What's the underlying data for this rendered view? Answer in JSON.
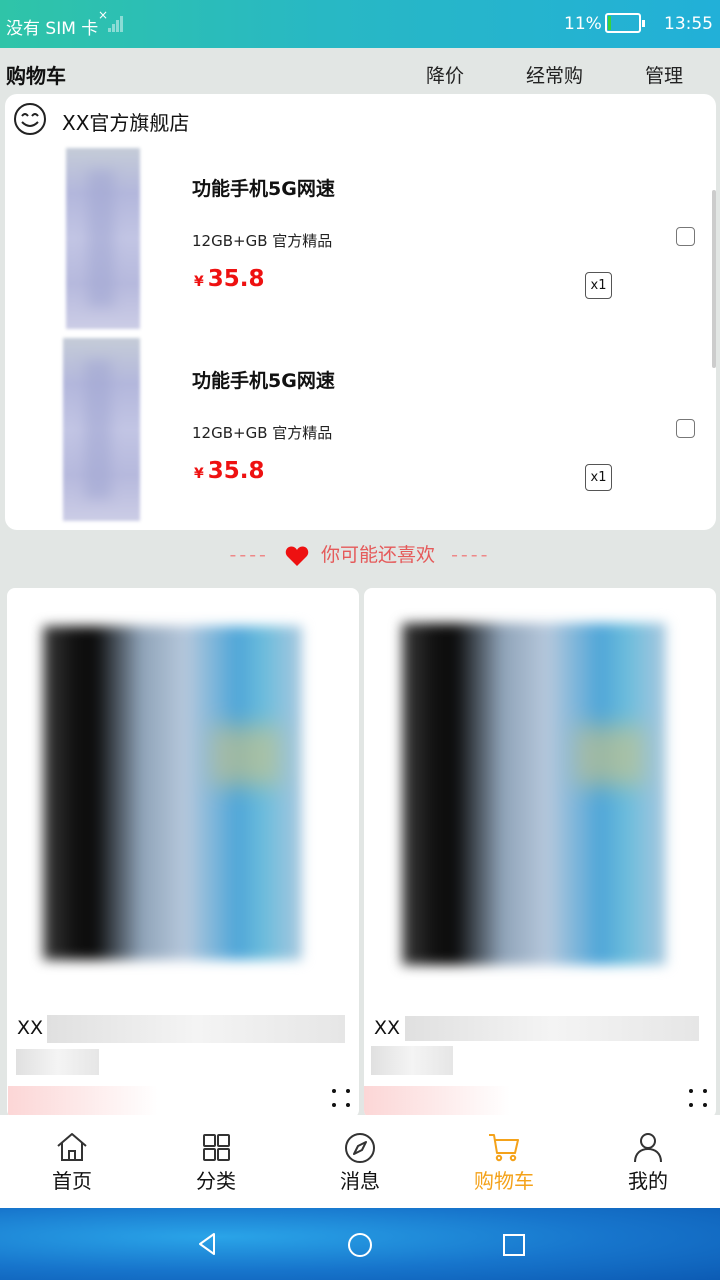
{
  "status_bar": {
    "sim_text": "没有 SIM 卡",
    "battery_percent_text": "11%",
    "battery_level": 0.11,
    "time": "13:55"
  },
  "title_bar": {
    "title": "购物车",
    "actions": [
      "降价",
      "经常购",
      "管理"
    ]
  },
  "store": {
    "name": "XX官方旗舰店",
    "icon": "smiley-face-icon"
  },
  "cart_items": [
    {
      "name": "功能手机5G网速",
      "spec": "12GB+GB 官方精品",
      "currency": "¥",
      "price": "35.8",
      "qty": "x1",
      "checked": false
    },
    {
      "name": "功能手机5G网速",
      "spec": "12GB+GB 官方精品",
      "currency": "¥",
      "price": "35.8",
      "qty": "x1",
      "checked": false
    }
  ],
  "recommend": {
    "dashes_left": "----",
    "label": "你可能还喜欢",
    "dashes_right": "----",
    "icon": "heart-icon"
  },
  "recommend_products": [
    {
      "brand": "XX"
    },
    {
      "brand": "XX"
    }
  ],
  "tab_bar": {
    "active_index": 3,
    "items": [
      {
        "label": "首页",
        "icon": "home-icon"
      },
      {
        "label": "分类",
        "icon": "grid-icon"
      },
      {
        "label": "消息",
        "icon": "compass-icon"
      },
      {
        "label": "购物车",
        "icon": "cart-icon"
      },
      {
        "label": "我的",
        "icon": "person-icon"
      }
    ]
  },
  "colors": {
    "price": "#ee1111",
    "active_tab": "#f4a21a",
    "recommend_text": "#e55a5a",
    "page_bg": "#e2e6e4"
  }
}
